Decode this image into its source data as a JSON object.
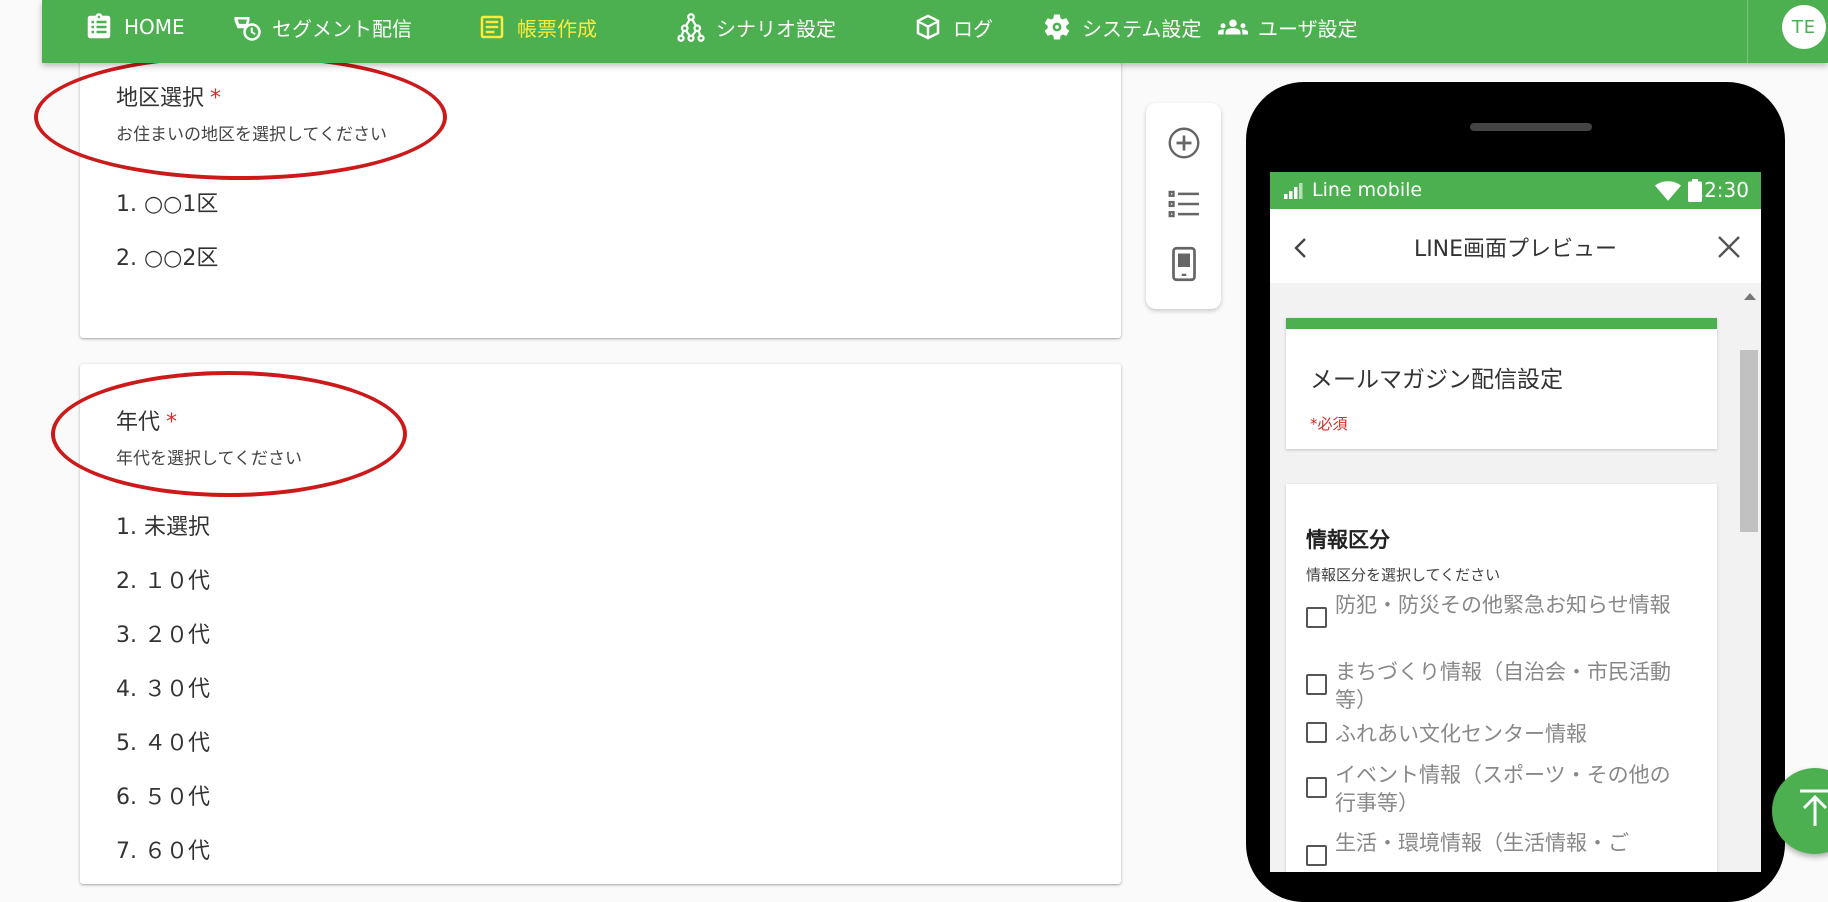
{
  "nav": {
    "home": "HOME",
    "segment": "セグメント配信",
    "forms": "帳票作成",
    "scenario": "シナリオ設定",
    "log": "ログ",
    "system": "システム設定",
    "users": "ユーザ設定",
    "avatar": "TE",
    "active_item": "forms"
  },
  "questions": [
    {
      "title": "地区選択",
      "required_mark": "*",
      "description": "お住まいの地区を選択してください",
      "options": [
        "1.  ○○1区",
        "2.  ○○2区"
      ]
    },
    {
      "title": "年代",
      "required_mark": "*",
      "description": "年代を選択してください",
      "options": [
        "1.  未選択",
        "2.  １０代",
        "3.  ２０代",
        "4.  ３０代",
        "5.  ４０代",
        "6.  ５０代",
        "7.  ６０代"
      ]
    }
  ],
  "toolbox": {
    "icons": [
      "add-circle-icon",
      "list-icon",
      "phone-preview-icon"
    ]
  },
  "preview": {
    "carrier": "Line mobile",
    "time": "12:30",
    "header_title": "LINE画面プレビュー",
    "form_title": "メールマガジン配信設定",
    "required_note": "*必須",
    "section_title": "情報区分",
    "section_desc": "情報区分を選択してください",
    "checkbox_options": [
      "防犯・防災その他緊急お知らせ情報",
      "まちづくり情報（自治会・市民活動等）",
      "ふれあい文化センター情報",
      "イベント情報（スポーツ・その他の行事等）",
      "生活・環境情報（生活情報・ご"
    ]
  },
  "colors": {
    "primary": "#4caf50",
    "active_nav": "#ffeb3b",
    "required": "#d32f2f",
    "annotation_circle": "#cc1a1a"
  }
}
